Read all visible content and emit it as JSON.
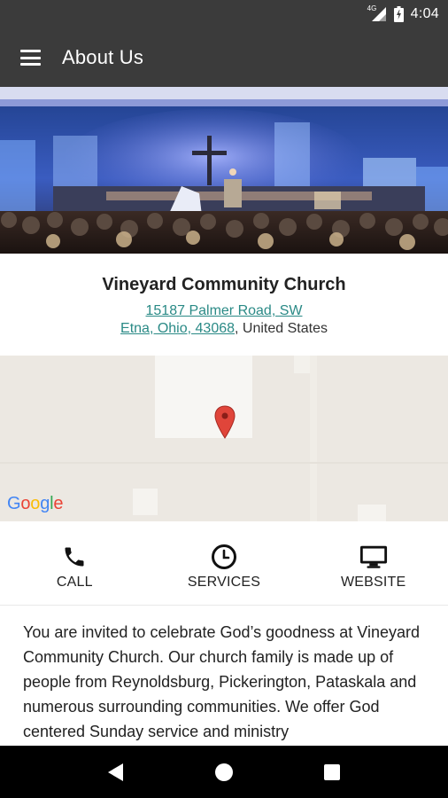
{
  "status_bar": {
    "network": "4G",
    "time": "4:04"
  },
  "app_bar": {
    "title": "About Us",
    "menu_icon": "menu-icon"
  },
  "church": {
    "name": "Vineyard Community Church",
    "address_line1": "15187 Palmer Road, SW",
    "address_line2_link": "Etna, Ohio, 43068",
    "address_line2_rest": ", United States"
  },
  "map": {
    "marker_icon": "map-pin-icon",
    "logo": "Google",
    "logo_colors": [
      "#4285F4",
      "#EA4335",
      "#FBBC05",
      "#4285F4",
      "#34A853",
      "#EA4335"
    ]
  },
  "actions": [
    {
      "label": "CALL",
      "icon": "phone-icon"
    },
    {
      "label": "SERVICES",
      "icon": "clock-icon"
    },
    {
      "label": "WEBSITE",
      "icon": "monitor-icon"
    }
  ],
  "description": "You are invited to celebrate God’s goodness at Vineyard Community Church.  Our church family is made up of people from Reynoldsburg, Pickerington, Pataskala and numerous surrounding communities. We offer God centered Sunday service and ministry",
  "nav_bar": {
    "back_icon": "back-icon",
    "home_icon": "home-icon",
    "recents_icon": "recents-icon"
  }
}
